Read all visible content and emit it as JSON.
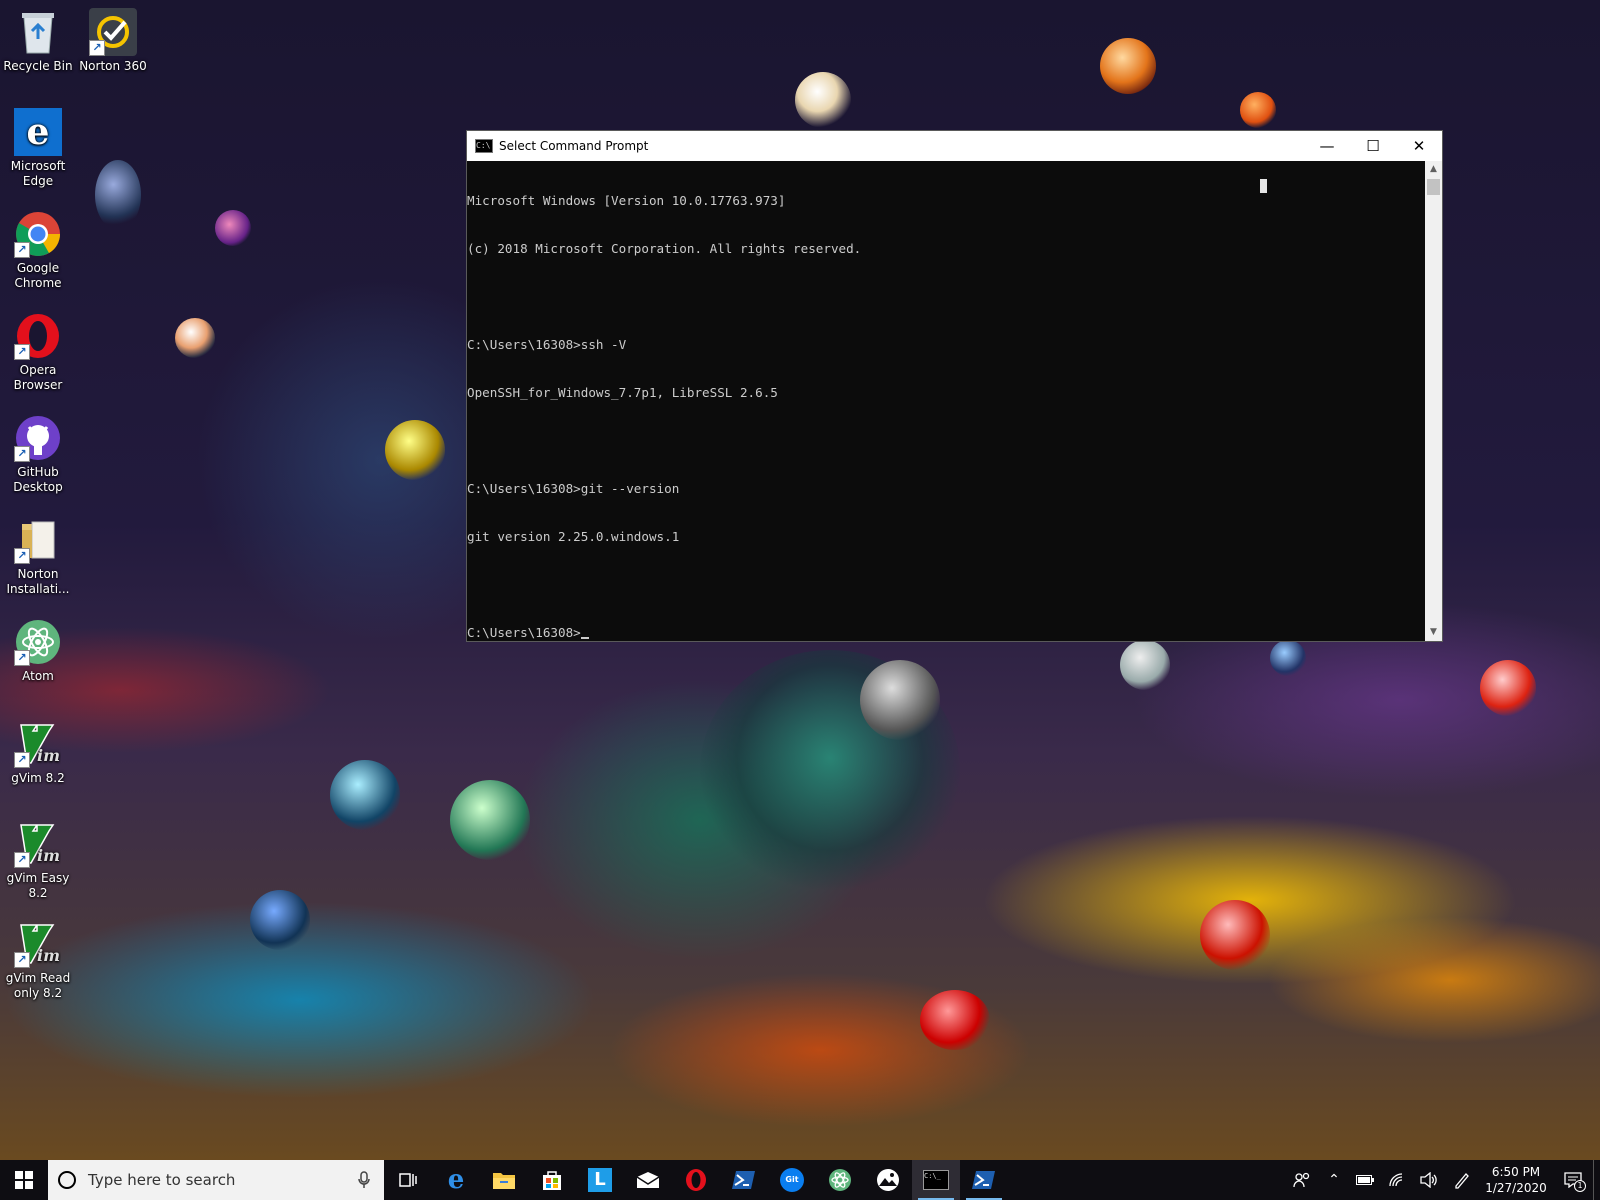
{
  "desktop": {
    "icons": [
      {
        "label": "Recycle Bin",
        "icon": "recycle-bin-icon"
      },
      {
        "label": "Norton 360",
        "icon": "norton-icon"
      },
      {
        "label": "Microsoft Edge",
        "icon": "edge-icon"
      },
      {
        "label": "Google Chrome",
        "icon": "chrome-icon"
      },
      {
        "label": "Opera Browser",
        "icon": "opera-icon"
      },
      {
        "label": "GitHub Desktop",
        "icon": "github-icon"
      },
      {
        "label": "Norton Installati...",
        "icon": "folder-icon"
      },
      {
        "label": "Atom",
        "icon": "atom-icon"
      },
      {
        "label": "gVim 8.2",
        "icon": "vim-icon"
      },
      {
        "label": "gVim Easy 8.2",
        "icon": "vim-icon"
      },
      {
        "label": "gVim Read only 8.2",
        "icon": "vim-icon"
      }
    ]
  },
  "console": {
    "title": "Select Command Prompt",
    "lines": [
      "Microsoft Windows [Version 10.0.17763.973]",
      "(c) 2018 Microsoft Corporation. All rights reserved.",
      "",
      "C:\\Users\\16308>ssh -V",
      "OpenSSH_for_Windows_7.7p1, LibreSSL 2.6.5",
      "",
      "C:\\Users\\16308>git --version",
      "git version 2.25.0.windows.1",
      "",
      "C:\\Users\\16308>"
    ],
    "controls": {
      "minimize": "—",
      "maximize": "☐",
      "close": "✕"
    }
  },
  "taskbar": {
    "search_placeholder": "Type here to search",
    "pinned": [
      {
        "icon": "task-view-icon"
      },
      {
        "icon": "edge-icon"
      },
      {
        "icon": "file-explorer-icon"
      },
      {
        "icon": "store-icon"
      },
      {
        "icon": "l-app-icon"
      },
      {
        "icon": "mail-icon"
      },
      {
        "icon": "opera-icon"
      },
      {
        "icon": "powershell-icon"
      },
      {
        "icon": "git-icon"
      },
      {
        "icon": "atom-icon"
      },
      {
        "icon": "photos-icon"
      },
      {
        "icon": "command-prompt-icon"
      },
      {
        "icon": "powershell-icon"
      }
    ],
    "clock": {
      "time": "6:50 PM",
      "date": "1/27/2020"
    },
    "notification_count": "1"
  }
}
